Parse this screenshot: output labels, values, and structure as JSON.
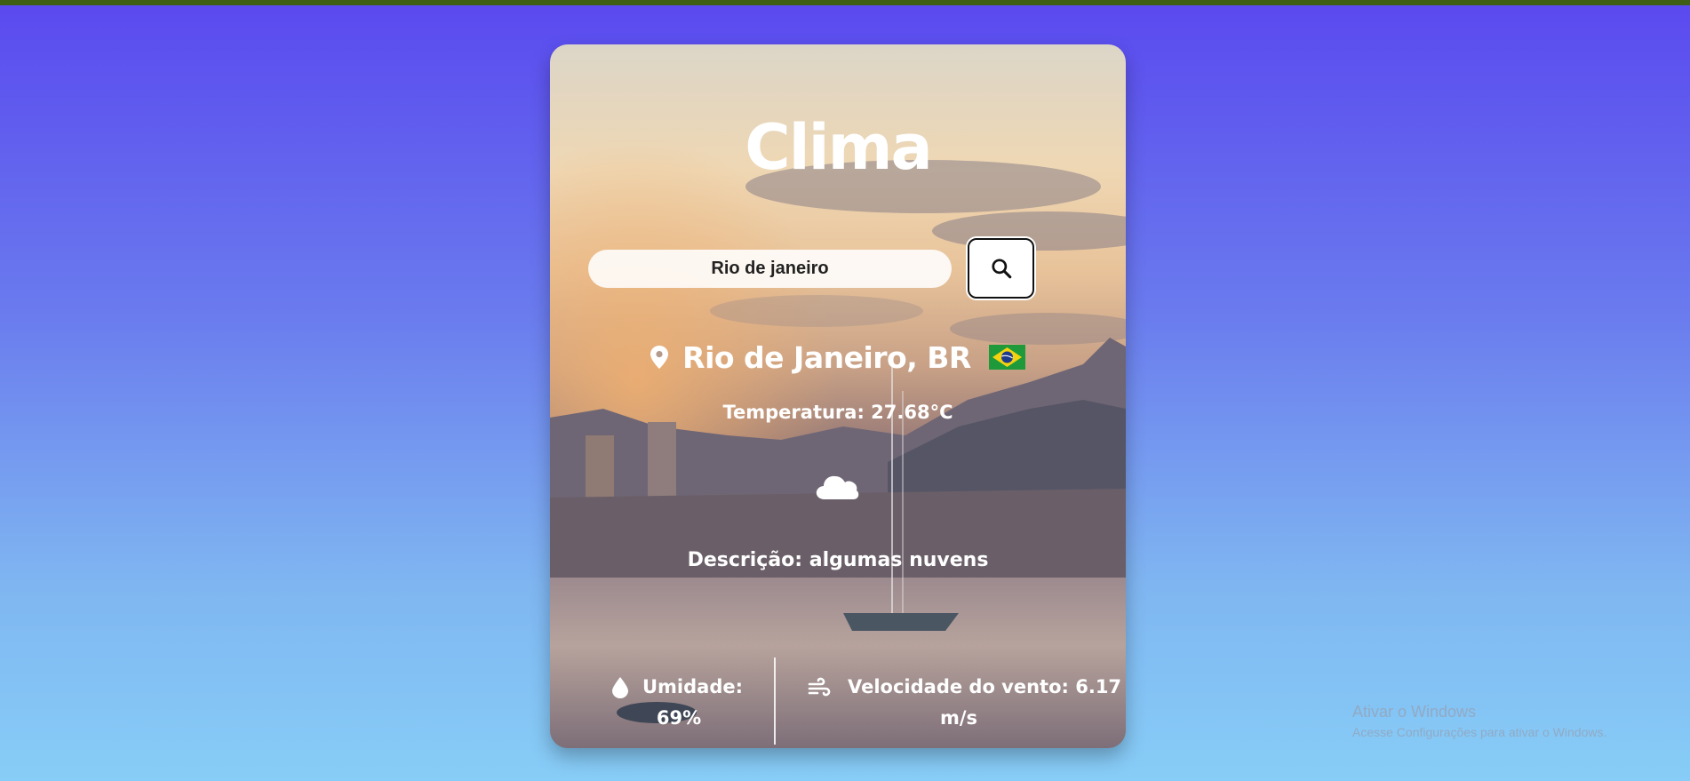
{
  "app": {
    "title": "Clima"
  },
  "search": {
    "value": "Rio de janeiro",
    "placeholder": "Rio de janeiro",
    "icon": "search-icon"
  },
  "location": {
    "city": "Rio de Janeiro, BR",
    "icon": "map-pin-icon",
    "flag": "brazil-flag-icon"
  },
  "weather": {
    "temperature": "Temperatura: 27.68°C",
    "icon": "cloud-icon",
    "description": "Descrição: algumas nuvens",
    "humidity_label": "Umidade:",
    "humidity_value": "69%",
    "humidity_icon": "water-drop-icon",
    "wind_label": "Velocidade do vento: 6.17",
    "wind_value": "m/s",
    "wind_icon": "wind-icon"
  },
  "watermark": {
    "title": "Ativar o Windows",
    "subtitle": "Acesse Configurações para ativar o Windows."
  },
  "colors": {
    "card_text": "#ffffff",
    "top_bar": "#3f5f14",
    "bg_top": "#5a49ef",
    "bg_bottom": "#87cdf7"
  }
}
